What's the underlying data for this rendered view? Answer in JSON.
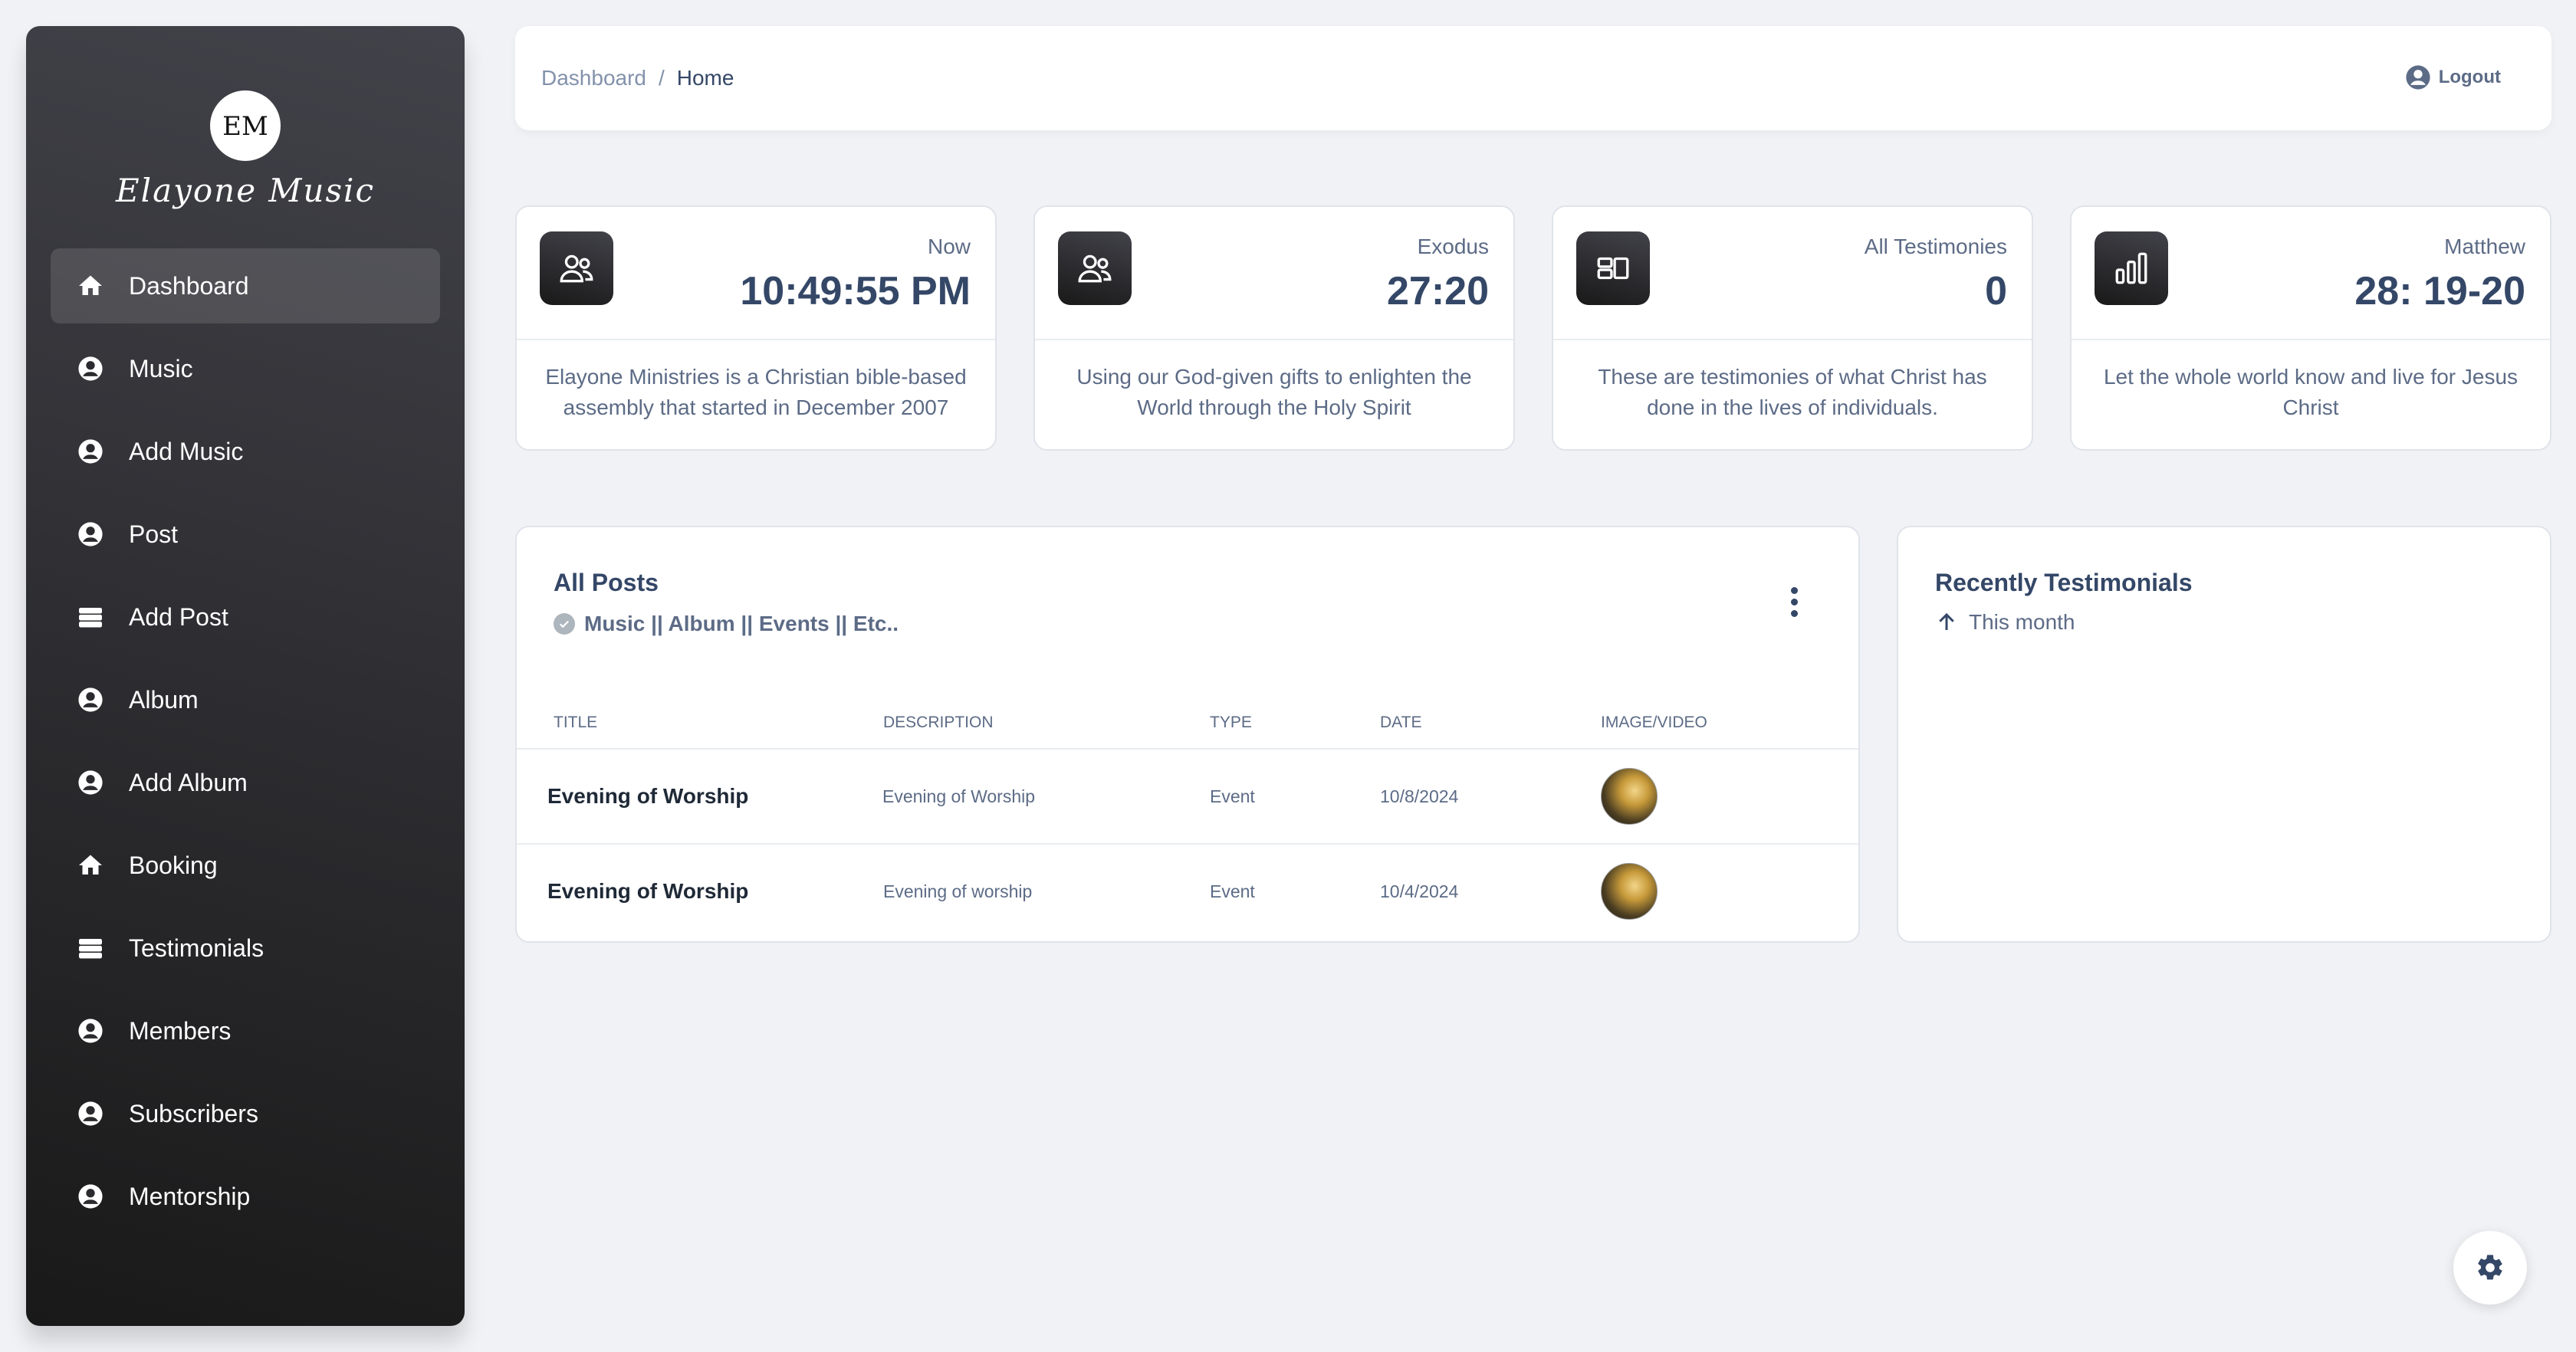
{
  "brand": {
    "name": "Elayone Music",
    "logo_letters": "EM"
  },
  "sidebar": {
    "items": [
      {
        "label": "Dashboard",
        "icon": "home-icon",
        "active": true
      },
      {
        "label": "Music",
        "icon": "user-circle-icon"
      },
      {
        "label": "Add Music",
        "icon": "user-circle-icon"
      },
      {
        "label": "Post",
        "icon": "user-circle-icon"
      },
      {
        "label": "Add Post",
        "icon": "storage-icon"
      },
      {
        "label": "Album",
        "icon": "user-circle-icon"
      },
      {
        "label": "Add Album",
        "icon": "user-circle-icon"
      },
      {
        "label": "Booking",
        "icon": "home-icon"
      },
      {
        "label": "Testimonials",
        "icon": "storage-icon"
      },
      {
        "label": "Members",
        "icon": "user-circle-icon"
      },
      {
        "label": "Subscribers",
        "icon": "user-circle-icon"
      },
      {
        "label": "Mentorship",
        "icon": "user-circle-icon"
      }
    ]
  },
  "header": {
    "breadcrumb": {
      "parent": "Dashboard",
      "separator": "/",
      "current": "Home"
    },
    "logout_label": "Logout"
  },
  "stats": [
    {
      "label": "Now",
      "value": "10:49:55 PM",
      "icon": "users-icon",
      "description": "Elayone Ministries is a Christian bible-based assembly that started in December 2007"
    },
    {
      "label": "Exodus",
      "value": "27:20",
      "icon": "users-icon",
      "description": "Using our God-given gifts to enlighten the World through the Holy Spirit"
    },
    {
      "label": "All Testimonies",
      "value": "0",
      "icon": "layout-icon",
      "description": "These are testimonies of what Christ has done in the lives of individuals."
    },
    {
      "label": "Matthew",
      "value": "28: 19-20",
      "icon": "bar-chart-icon",
      "description": "Let the whole world know and live for Jesus Christ"
    }
  ],
  "posts": {
    "title": "All Posts",
    "subtitle": "Music || Album || Events || Etc..",
    "columns": [
      "TITLE",
      "DESCRIPTION",
      "TYPE",
      "DATE",
      "IMAGE/VIDEO"
    ],
    "rows": [
      {
        "title": "Evening of Worship",
        "description": "Evening of Worship",
        "type": "Event",
        "date": "10/8/2024"
      },
      {
        "title": "Evening of Worship",
        "description": "Evening of worship",
        "type": "Event",
        "date": "10/4/2024"
      }
    ]
  },
  "testimonials": {
    "title": "Recently Testimonials",
    "subtitle": "This month"
  },
  "colors": {
    "sidebar_dark": "#191919",
    "accent_text": "#344767",
    "muted_text": "#5c6b86"
  }
}
